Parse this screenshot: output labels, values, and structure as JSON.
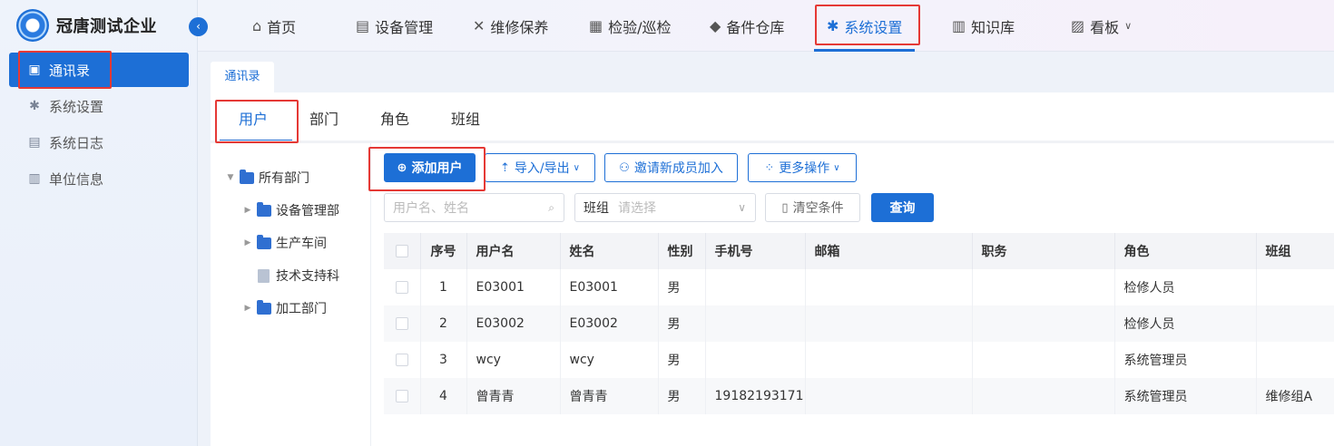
{
  "brand": {
    "name": "冠唐测试企业"
  },
  "sidebar": {
    "collapse_icon": "chevron-left-icon",
    "items": [
      {
        "label": "通讯录",
        "icon": "contacts-icon",
        "active": true
      },
      {
        "label": "系统设置",
        "icon": "gear-icon",
        "active": false
      },
      {
        "label": "系统日志",
        "icon": "log-icon",
        "active": false
      },
      {
        "label": "单位信息",
        "icon": "building-icon",
        "active": false
      }
    ]
  },
  "topnav": {
    "items": [
      {
        "label": "首页",
        "icon": "home-icon"
      },
      {
        "label": "设备管理",
        "icon": "server-icon"
      },
      {
        "label": "维修保养",
        "icon": "tools-icon"
      },
      {
        "label": "检验/巡检",
        "icon": "inspection-icon"
      },
      {
        "label": "备件仓库",
        "icon": "box-icon"
      },
      {
        "label": "系统设置",
        "icon": "gear-icon",
        "active": true
      },
      {
        "label": "知识库",
        "icon": "books-icon"
      },
      {
        "label": "看板",
        "icon": "dashboard-icon",
        "has_dropdown": true
      }
    ]
  },
  "page_tab": {
    "label": "通讯录"
  },
  "subtabs": [
    "用户",
    "部门",
    "角色",
    "班组"
  ],
  "tree": {
    "root": "所有部门",
    "children": [
      "设备管理部",
      "生产车间",
      "技术支持科",
      "加工部门"
    ]
  },
  "toolbar": {
    "add_user": "添加用户",
    "import_export": "导入/导出",
    "invite": "邀请新成员加入",
    "more": "更多操作"
  },
  "filters": {
    "search_placeholder": "用户名、姓名",
    "group_label": "班组",
    "group_placeholder": "请选择",
    "clear": "清空条件",
    "query": "查询"
  },
  "table": {
    "headers": [
      "序号",
      "用户名",
      "姓名",
      "性别",
      "手机号",
      "邮箱",
      "职务",
      "角色",
      "班组"
    ],
    "rows": [
      {
        "no": "1",
        "username": "E03001",
        "name": "E03001",
        "gender": "男",
        "phone": "",
        "email": "",
        "title": "",
        "role": "检修人员",
        "group": ""
      },
      {
        "no": "2",
        "username": "E03002",
        "name": "E03002",
        "gender": "男",
        "phone": "",
        "email": "",
        "title": "",
        "role": "检修人员",
        "group": ""
      },
      {
        "no": "3",
        "username": "wcy",
        "name": "wcy",
        "gender": "男",
        "phone": "",
        "email": "",
        "title": "",
        "role": "系统管理员",
        "group": ""
      },
      {
        "no": "4",
        "username": "曾青青",
        "name": "曾青青",
        "gender": "男",
        "phone": "19182193171",
        "email": "",
        "title": "",
        "role": "系统管理员",
        "group": "维修组A"
      }
    ]
  },
  "colors": {
    "primary": "#1d6fd6",
    "highlight": "#e53935"
  }
}
